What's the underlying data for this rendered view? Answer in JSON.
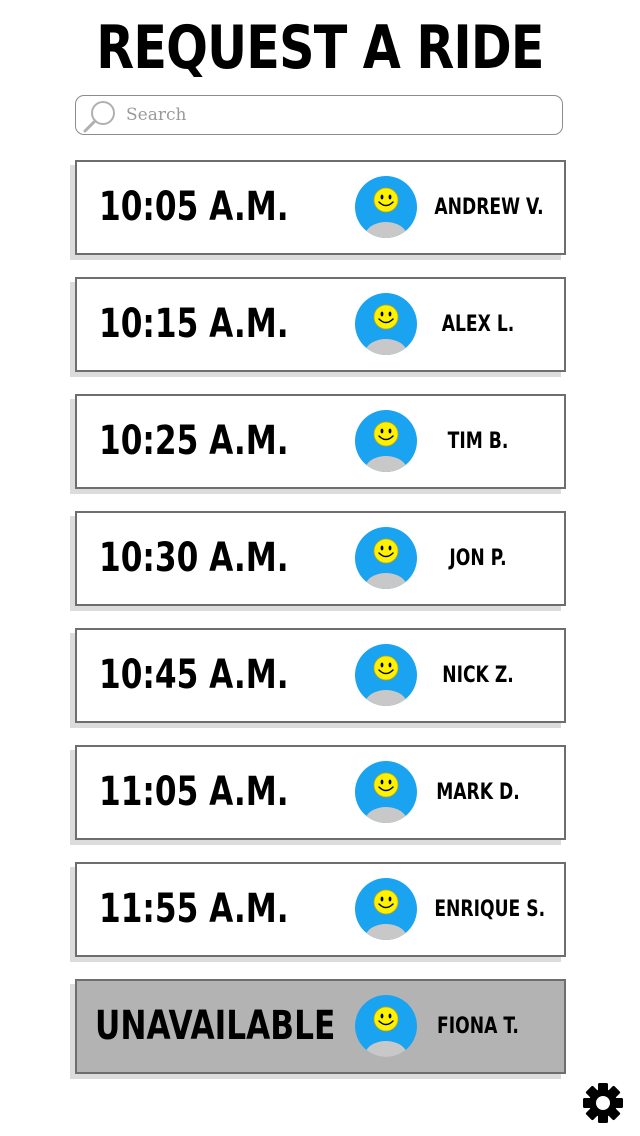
{
  "header": {
    "title": "REQUEST A RIDE"
  },
  "search": {
    "placeholder": "Search",
    "value": "",
    "icon": "search-icon"
  },
  "rides": [
    {
      "time": "10:05 A.M.",
      "driver": "ANDREW V.",
      "available": true,
      "avatar_icon": "smiley-avatar-icon"
    },
    {
      "time": "10:15 A.M.",
      "driver": "ALEX L.",
      "available": true,
      "avatar_icon": "smiley-avatar-icon"
    },
    {
      "time": "10:25 A.M.",
      "driver": "TIM B.",
      "available": true,
      "avatar_icon": "smiley-avatar-icon"
    },
    {
      "time": "10:30 A.M.",
      "driver": "JON P.",
      "available": true,
      "avatar_icon": "smiley-avatar-icon"
    },
    {
      "time": "10:45 A.M.",
      "driver": "NICK Z.",
      "available": true,
      "avatar_icon": "smiley-avatar-icon"
    },
    {
      "time": "11:05 A.M.",
      "driver": "MARK D.",
      "available": true,
      "avatar_icon": "smiley-avatar-icon"
    },
    {
      "time": "11:55 A.M.",
      "driver": "ENRIQUE S.",
      "available": true,
      "avatar_icon": "smiley-avatar-icon"
    },
    {
      "time": "UNAVAILABLE",
      "driver": "FIONA T.",
      "available": false,
      "avatar_icon": "smiley-avatar-icon"
    }
  ],
  "footer": {
    "settings_icon": "gear-icon"
  },
  "colors": {
    "avatar_background": "#1aa3f0",
    "smiley_face": "#fff200",
    "avatar_body": "#c8c8c8",
    "row_border": "#6e6e6e",
    "unavailable_background": "#b3b3b3"
  }
}
